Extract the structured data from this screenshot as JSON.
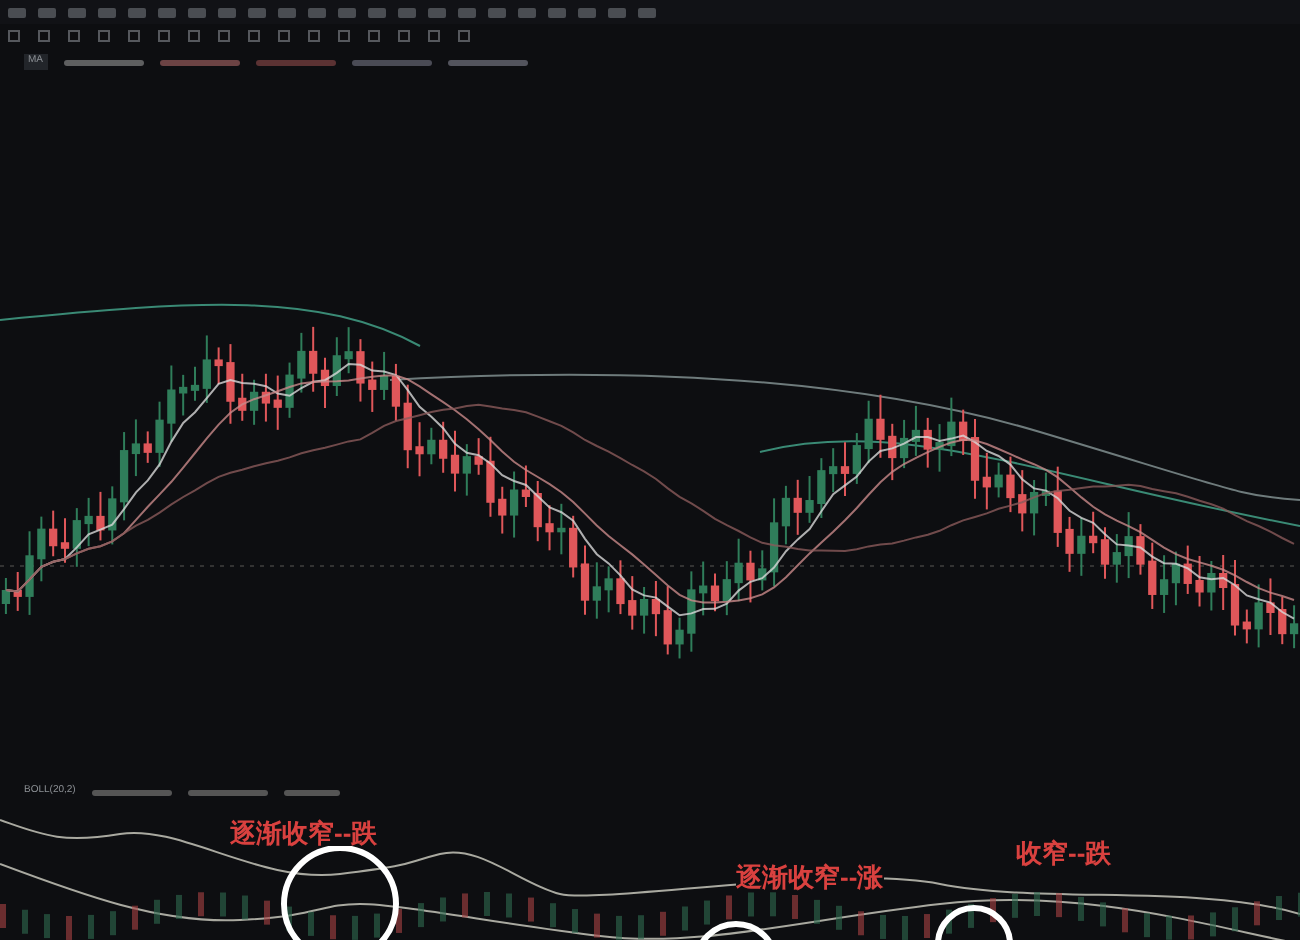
{
  "main_legend": {
    "label": "MA"
  },
  "indicator_legend": {
    "label": "BOLL(20,2)"
  },
  "annotations": [
    {
      "text": "逐渐收窄--跌",
      "color": "#d9413f"
    },
    {
      "text": "逐渐收窄--涨",
      "color": "#d9413f"
    },
    {
      "text": "收窄--跌",
      "color": "#d9413f"
    }
  ]
}
